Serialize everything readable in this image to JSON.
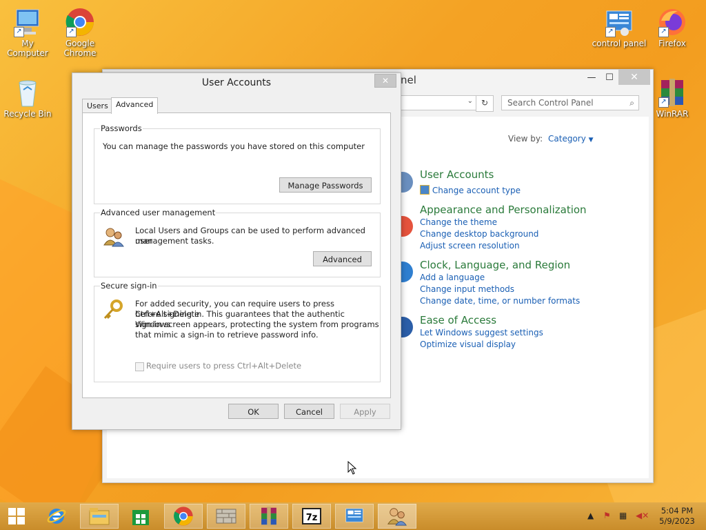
{
  "desktop": {
    "icons": [
      {
        "label": "My Computer"
      },
      {
        "label": "Google\nChrome"
      },
      {
        "label": "Recycle Bin"
      },
      {
        "label": "control panel"
      },
      {
        "label": "Firefox"
      },
      {
        "label": "WinRAR"
      }
    ]
  },
  "control_panel": {
    "title": "nel",
    "search_placeholder": "Search Control Panel",
    "view_by_label": "View by:",
    "view_by_value": "Category",
    "categories": [
      {
        "title": "User Accounts",
        "links": [
          "Change account type"
        ]
      },
      {
        "title": "Appearance and Personalization",
        "links": [
          "Change the theme",
          "Change desktop background",
          "Adjust screen resolution"
        ]
      },
      {
        "title": "Clock, Language, and Region",
        "links": [
          "Add a language",
          "Change input methods",
          "Change date, time, or number formats"
        ]
      },
      {
        "title": "Ease of Access",
        "links": [
          "Let Windows suggest settings",
          "Optimize visual display"
        ]
      }
    ]
  },
  "dialog": {
    "title": "User Accounts",
    "tabs": [
      {
        "label": "Users"
      },
      {
        "label": "Advanced"
      }
    ],
    "passwords": {
      "label": "Passwords",
      "text": "You can manage the passwords you have stored on this computer",
      "button": "Manage Passwords"
    },
    "advanced_mgmt": {
      "label": "Advanced user management",
      "text_line1": "Local Users and Groups can be used to perform advanced user",
      "text_line2": "management tasks.",
      "button": "Advanced"
    },
    "secure_signin": {
      "label": "Secure sign-in",
      "text_line1": "For added security, you can require users to press Ctrl+Alt+Delete",
      "text_line2": "before signing in. This guarantees that the authentic Windows",
      "text_line3": "sign-in screen appears, protecting the system from programs",
      "text_line4": "that mimic a sign-in to retrieve password info.",
      "checkbox_label": "Require users to press Ctrl+Alt+Delete",
      "checkbox_checked": false
    },
    "buttons": {
      "ok": "OK",
      "cancel": "Cancel",
      "apply": "Apply"
    }
  },
  "taskbar": {
    "clock_time": "5:04 PM",
    "clock_date": "5/9/2023"
  },
  "colors": {
    "link": "#1a5fb4",
    "category_head": "#2a7a3a",
    "taskbar": "#d9a03a"
  }
}
